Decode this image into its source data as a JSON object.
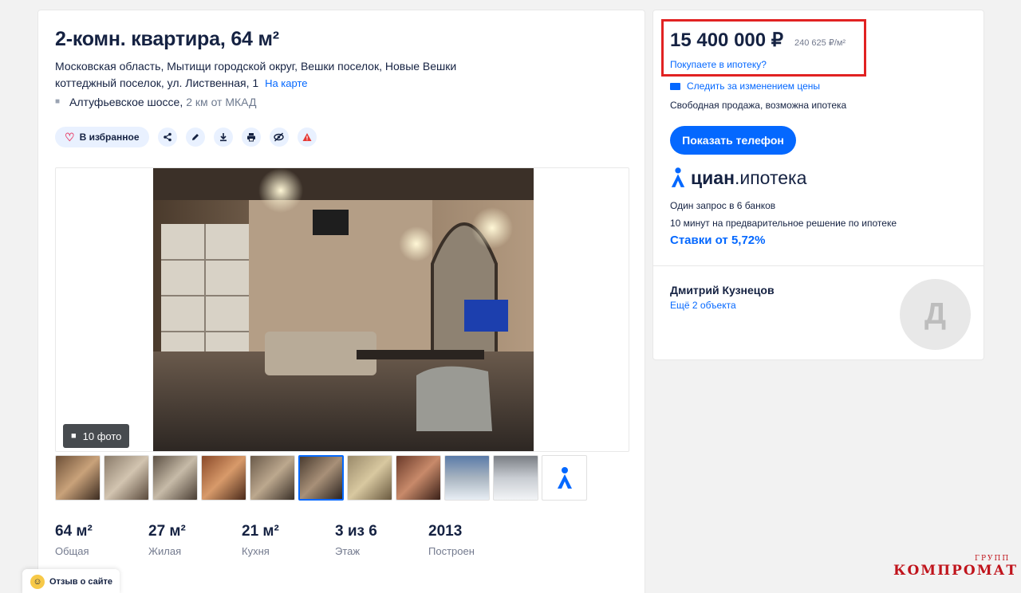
{
  "listing": {
    "title": "2-комн. квартира, 64 м²",
    "address": "Московская область, Мытищи городской округ, Вешки поселок, Новые Вешки коттеджный поселок, ул. Лиственная, 1",
    "map_link": "На карте",
    "highway": "Алтуфьевское шоссе,",
    "highway_distance": "2 км от МКАД"
  },
  "actions": {
    "favorite_label": "В избранное",
    "icons": [
      "share-icon",
      "edit-icon",
      "download-icon",
      "print-icon",
      "hide-icon",
      "report-icon"
    ]
  },
  "gallery": {
    "photo_count_label": "10 фото",
    "thumbnail_count": 10,
    "active_thumbnail": 6
  },
  "facts": [
    {
      "value": "64 м²",
      "label": "Общая"
    },
    {
      "value": "27 м²",
      "label": "Жилая"
    },
    {
      "value": "21 м²",
      "label": "Кухня"
    },
    {
      "value": "3 из 6",
      "label": "Этаж"
    },
    {
      "value": "2013",
      "label": "Построен"
    }
  ],
  "feedback": {
    "label": "Отзыв о сайте"
  },
  "sidebar": {
    "price": "15 400 000 ₽",
    "price_per_m2": "240 625 ₽/м²",
    "mortgage_question": "Покупаете в ипотеку?",
    "follow_price": "Следить за изменением цены",
    "sale_type": "Свободная продажа, возможна ипотека",
    "phone_button": "Показать телефон",
    "cian_brand": "циан",
    "cian_brand_suffix": ".ипотека",
    "bank_line1": "Один запрос в 6 банков",
    "bank_line2": "10 минут на предварительное решение по ипотеке",
    "rates": "Ставки от 5,72%",
    "agent_name": "Дмитрий Кузнецов",
    "agent_more": "Ещё 2 объекта",
    "avatar_letter": "Д"
  },
  "watermark": {
    "main": "КОМПРОМАТ",
    "small": "ГРУПП"
  },
  "colors": {
    "accent": "#0468ff",
    "highlight_border": "#e12222",
    "text": "#152242"
  }
}
